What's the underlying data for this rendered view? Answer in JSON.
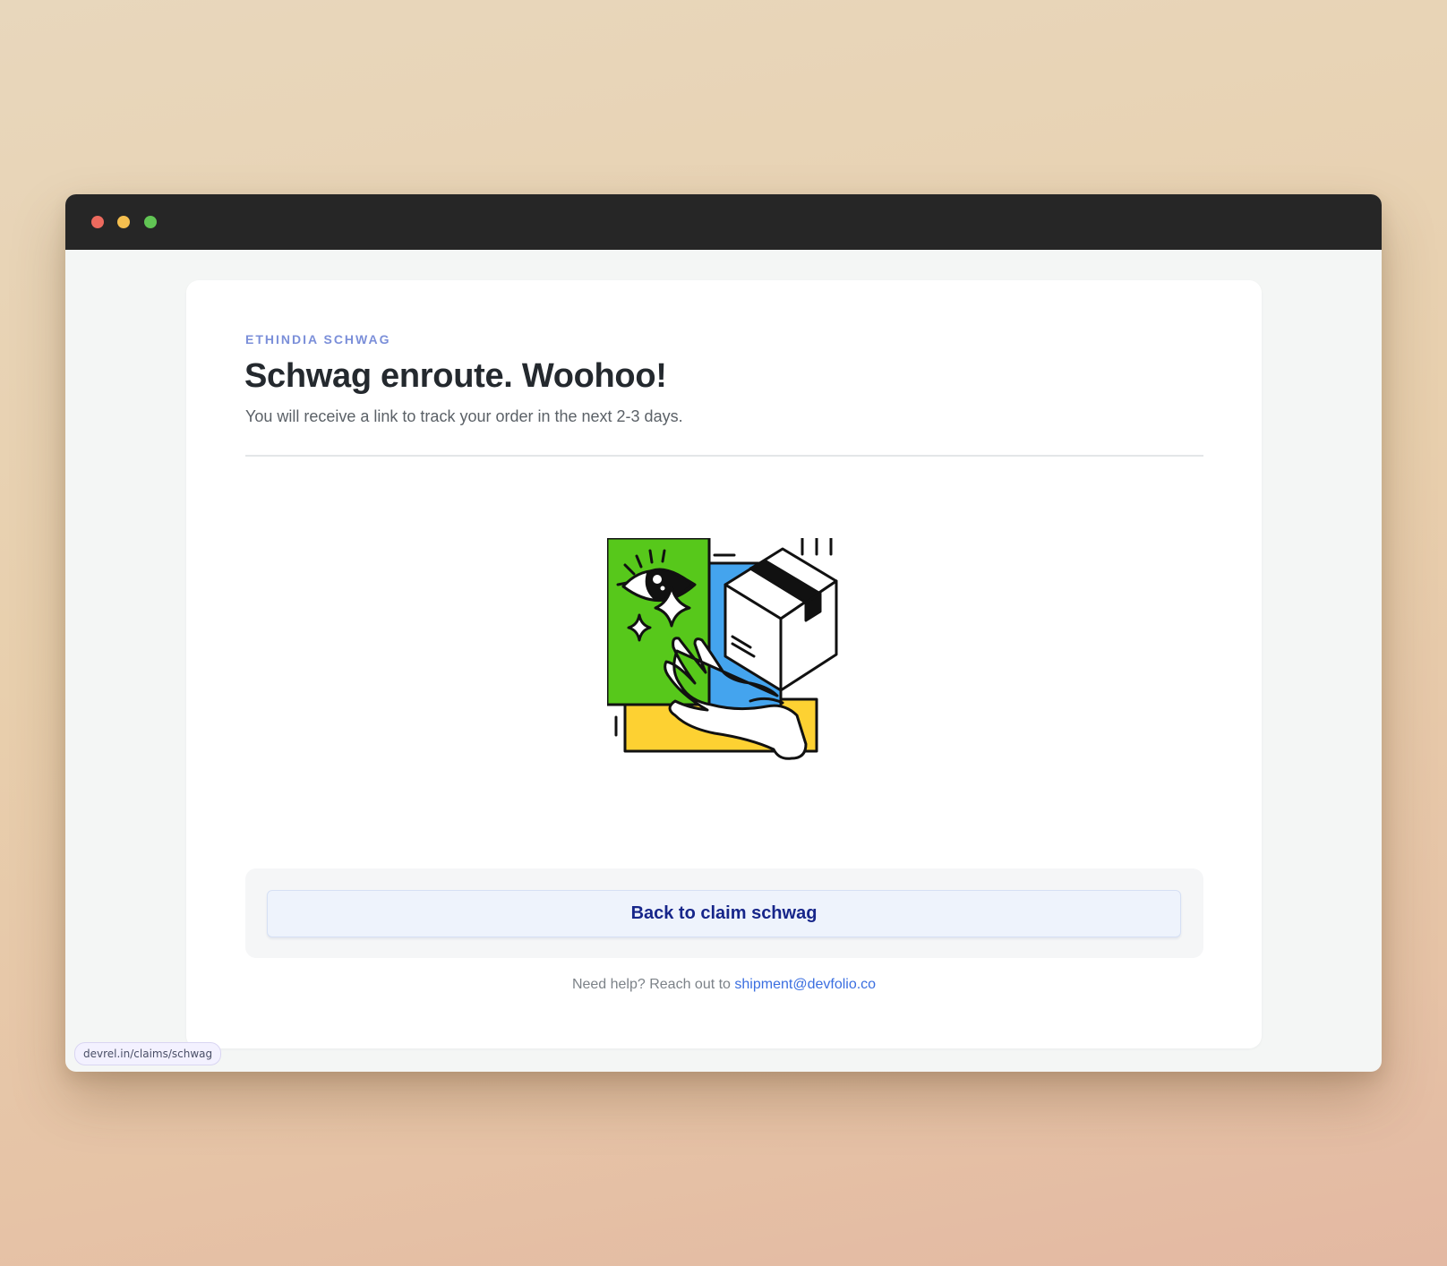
{
  "browser": {
    "controls": [
      "close",
      "minimize",
      "maximize"
    ],
    "status_url": "devrel.in/claims/schwag"
  },
  "page": {
    "eyebrow": "ETHINDIA SCHWAG",
    "title": "Schwag enroute. Woohoo!",
    "subtitle": "You will receive a link to track your order in the next 2-3 days.",
    "illustration_icon": "hand-holding-package-illustration",
    "back_button_label": "Back to claim schwag",
    "help_text": "Need help? Reach out to",
    "help_email": "shipment@devfolio.co"
  },
  "colors": {
    "eyebrow": "#7b8fd9",
    "button_text": "#17268a",
    "link": "#3a6ee0",
    "illustration_green": "#57c81b",
    "illustration_blue": "#44a4ee",
    "illustration_yellow": "#fdd132"
  }
}
